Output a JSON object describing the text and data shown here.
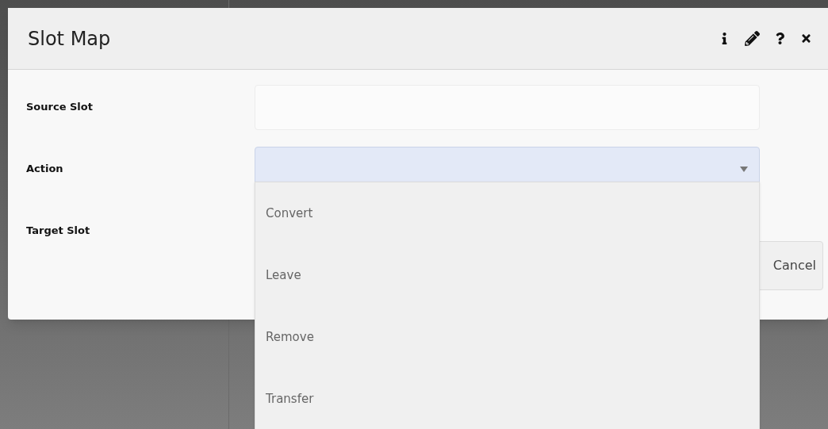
{
  "dialog": {
    "title": "Slot Map",
    "header_buttons": [
      {
        "kind": "info"
      },
      {
        "kind": "edit"
      },
      {
        "kind": "help"
      },
      {
        "kind": "close"
      }
    ]
  },
  "fields": [
    {
      "label": "Source Slot",
      "kind": "text"
    },
    {
      "label": "Action",
      "kind": "select",
      "focused": true
    },
    {
      "label": "Target Slot",
      "kind": "none"
    }
  ],
  "dropdown": {
    "options": [
      {
        "label": "Convert",
        "selected": false
      },
      {
        "label": "Leave",
        "selected": false
      },
      {
        "label": "Remove",
        "selected": false
      },
      {
        "label": "Transfer",
        "selected": false
      }
    ]
  },
  "buttons": [
    {
      "label": "Cancel"
    }
  ]
}
